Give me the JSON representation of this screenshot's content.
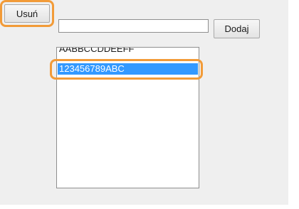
{
  "form": {
    "new_entry_value": "",
    "add_label": "Dodaj",
    "remove_label": "Usuń"
  },
  "list": {
    "items": [
      {
        "label": "AABBCCDDEEFF",
        "selected": false
      },
      {
        "label": "123456789ABC",
        "selected": true
      }
    ]
  },
  "colors": {
    "selection": "#3399ff",
    "highlight": "#f29b38",
    "panel": "#efefef"
  }
}
